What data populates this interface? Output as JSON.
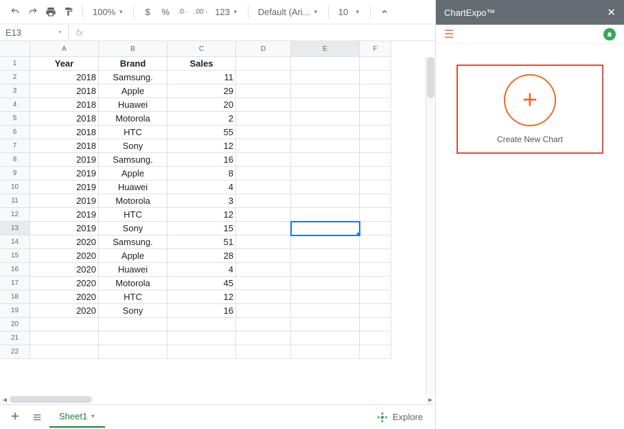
{
  "toolbar": {
    "zoom": "100%",
    "currency": "$",
    "percent": "%",
    "font": "Default (Ari...",
    "fontsize": "10"
  },
  "namebox": "E13",
  "columns": [
    "A",
    "B",
    "C",
    "D",
    "E",
    "F"
  ],
  "colwidths": {
    "A": 100,
    "B": 100,
    "C": 100,
    "D": 80,
    "E": 100,
    "F": 46
  },
  "headers": {
    "A": "Year",
    "B": "Brand",
    "C": "Sales"
  },
  "rows": [
    {
      "A": "2018",
      "B": "Samsung.",
      "C": "11"
    },
    {
      "A": "2018",
      "B": "Apple",
      "C": "29"
    },
    {
      "A": "2018",
      "B": "Huawei",
      "C": "20"
    },
    {
      "A": "2018",
      "B": "Motorola",
      "C": "2"
    },
    {
      "A": "2018",
      "B": "HTC",
      "C": "55"
    },
    {
      "A": "2018",
      "B": "Sony",
      "C": "12"
    },
    {
      "A": "2019",
      "B": "Samsung.",
      "C": "16"
    },
    {
      "A": "2019",
      "B": "Apple",
      "C": "8"
    },
    {
      "A": "2019",
      "B": "Huawei",
      "C": "4"
    },
    {
      "A": "2019",
      "B": "Motorola",
      "C": "3"
    },
    {
      "A": "2019",
      "B": "HTC",
      "C": "12"
    },
    {
      "A": "2019",
      "B": "Sony",
      "C": "15"
    },
    {
      "A": "2020",
      "B": "Samsung.",
      "C": "51"
    },
    {
      "A": "2020",
      "B": "Apple",
      "C": "28"
    },
    {
      "A": "2020",
      "B": "Huawei",
      "C": "4"
    },
    {
      "A": "2020",
      "B": "Motorola",
      "C": "45"
    },
    {
      "A": "2020",
      "B": "HTC",
      "C": "12"
    },
    {
      "A": "2020",
      "B": "Sony",
      "C": "16"
    }
  ],
  "total_rows": 22,
  "selected_cell": {
    "row": 13,
    "col": "E"
  },
  "sheet_tab": "Sheet1",
  "explore_label": "Explore",
  "sidepanel": {
    "title": "ChartExpo™",
    "create_label": "Create New Chart"
  }
}
